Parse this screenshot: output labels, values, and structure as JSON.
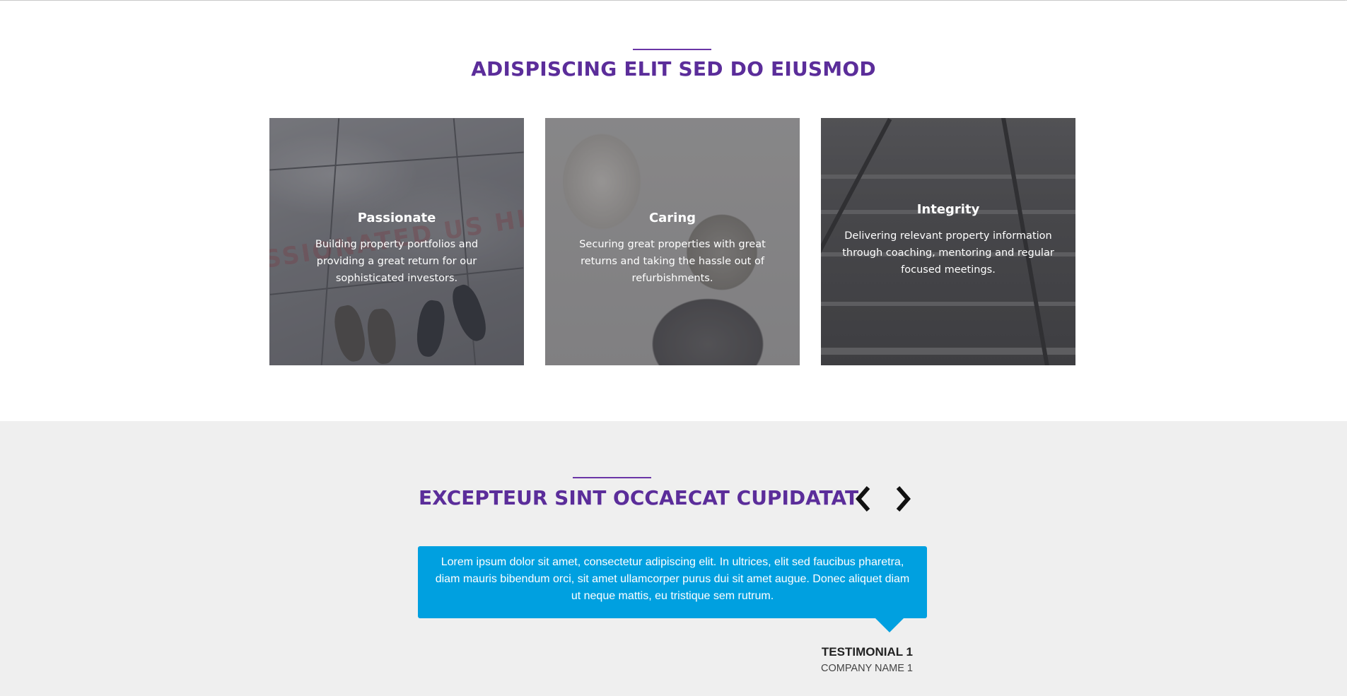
{
  "features": {
    "heading": "ADISPISCING ELIT SED DO EIUSMOD",
    "cards": [
      {
        "title": "Passionate",
        "text": "Building property portfolios and providing a great return for our sophisticated investors.",
        "watermark": "SSIONATED US HI"
      },
      {
        "title": "Caring",
        "text": "Securing great properties with great returns and taking the hassle out of refurbishments."
      },
      {
        "title": "Integrity",
        "text": "Delivering relevant property information through coaching, mentoring and regular focused meetings."
      }
    ]
  },
  "testimonials": {
    "heading": "EXCEPTEUR SINT OCCAECAT CUPIDATAT",
    "prev_icon": "chevron-left-icon",
    "next_icon": "chevron-right-icon",
    "quote": "Lorem ipsum dolor sit amet, consectetur adipiscing elit. In ultrices, elit sed faucibus pharetra, diam mauris bibendum orci, sit amet ullamcorper purus dui sit amet augue. Donec aliquet diam ut neque mattis, eu tristique sem rutrum.",
    "author_name": "TESTIMONIAL 1",
    "company_name": "COMPANY NAME 1"
  },
  "colors": {
    "heading": "#5b2d9a",
    "accent_line": "#6a35a6",
    "quote_background": "#00a0e0",
    "section_background": "#efefef"
  }
}
